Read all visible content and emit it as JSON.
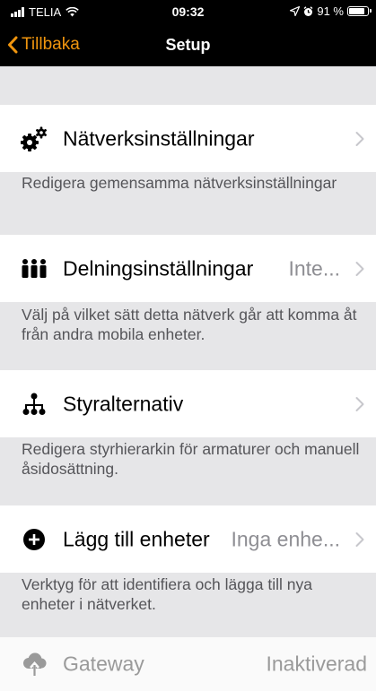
{
  "status_bar": {
    "carrier": "TELIA",
    "time": "09:32",
    "battery": "91 %",
    "battery_level": 0.91
  },
  "nav": {
    "back_label": "Tillbaka",
    "title": "Setup"
  },
  "rows": [
    {
      "label": "Nätverksinställningar",
      "value": "",
      "icon": "gears-icon",
      "description": "Redigera gemensamma nätverksinställningar"
    },
    {
      "label": "Delningsinställningar",
      "value": "Inte...",
      "icon": "people-icon",
      "description": "Välj på vilket sätt detta nätverk går att komma åt från andra mobila enheter."
    },
    {
      "label": "Styralternativ",
      "value": "",
      "icon": "hierarchy-icon",
      "description": "Redigera styrhierarkin för armaturer och manuell åsidosättning."
    },
    {
      "label": "Lägg till enheter",
      "value": "Inga enhe...",
      "icon": "add-circle-icon",
      "description": "Verktyg för att identifiera och lägga till nya enheter i nätverket."
    },
    {
      "label": "Gateway",
      "value": "Inaktiverad",
      "icon": "cloud-upload-icon",
      "description": ""
    }
  ]
}
